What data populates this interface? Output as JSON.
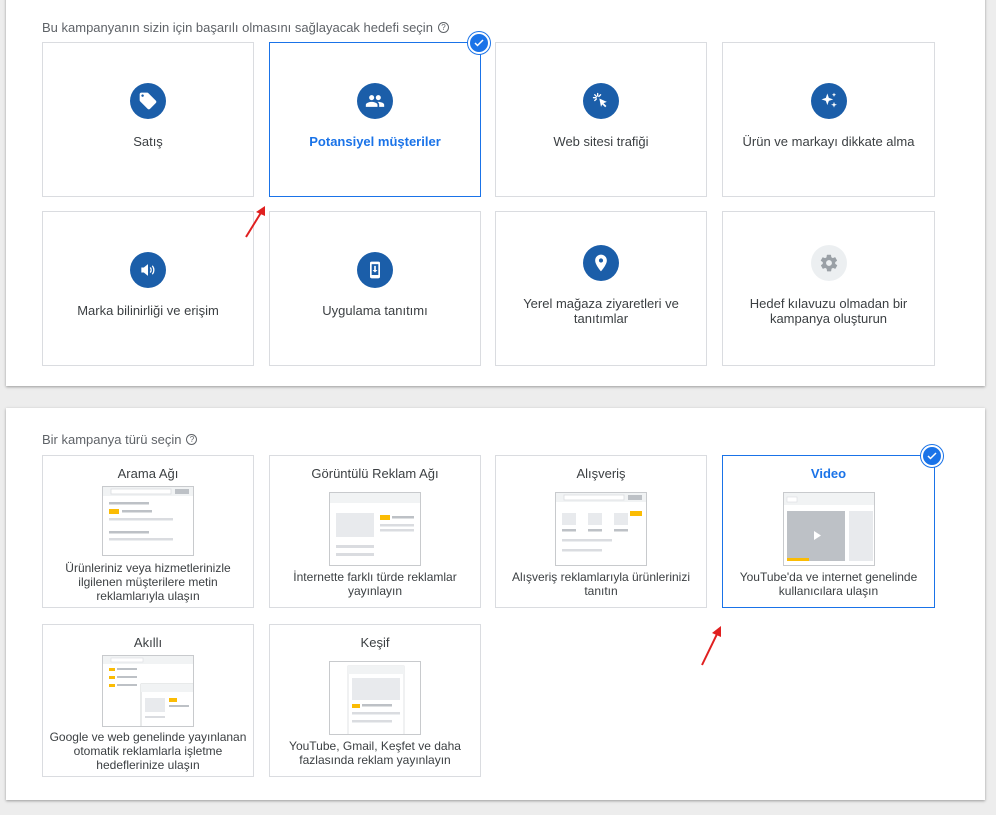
{
  "goals": {
    "title": "Bu kampanyanın sizin için başarılı olmasını sağlayacak hedefi seçin",
    "help": "?",
    "cards": [
      {
        "label": "Satış",
        "icon": "tag-icon"
      },
      {
        "label": "Potansiyel müşteriler",
        "icon": "people-icon",
        "selected": true
      },
      {
        "label": "Web sitesi trafiği",
        "icon": "cursor-click-icon"
      },
      {
        "label": "Ürün ve markayı dikkate alma",
        "icon": "sparkle-icon"
      },
      {
        "label": "Marka bilinirliği ve erişim",
        "icon": "megaphone-icon"
      },
      {
        "label": "Uygulama tanıtımı",
        "icon": "phone-download-icon"
      },
      {
        "label": "Yerel mağaza ziyaretleri ve tanıtımlar",
        "icon": "location-pin-icon"
      },
      {
        "label": "Hedef kılavuzu olmadan bir kampanya oluşturun",
        "icon": "gear-icon"
      }
    ]
  },
  "types": {
    "title": "Bir kampanya türü seçin",
    "help": "?",
    "cards": [
      {
        "title": "Arama Ağı",
        "desc": "Ürünleriniz veya hizmetlerinizle ilgilenen müşterilere metin reklamlarıyla ulaşın"
      },
      {
        "title": "Görüntülü Reklam Ağı",
        "desc": "İnternette farklı türde reklamlar yayınlayın"
      },
      {
        "title": "Alışveriş",
        "desc": "Alışveriş reklamlarıyla ürünlerinizi tanıtın"
      },
      {
        "title": "Video",
        "desc": "YouTube'da ve internet genelinde kullanıcılara ulaşın",
        "selected": true
      },
      {
        "title": "Akıllı",
        "desc": "Google ve web genelinde yayınlanan otomatik reklamlarla işletme hedeflerinize ulaşın"
      },
      {
        "title": "Keşif",
        "desc": "YouTube, Gmail, Keşfet ve daha fazlasında reklam yayınlayın"
      }
    ]
  },
  "colors": {
    "accent": "#1a73e8",
    "icon_bg": "#1b5ea9",
    "annotation_arrow": "#e02020"
  }
}
